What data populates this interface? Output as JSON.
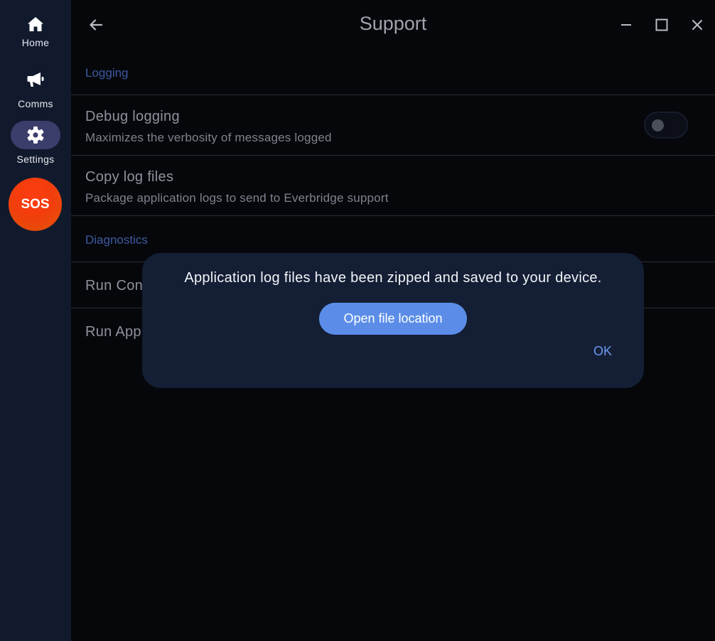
{
  "sidebar": {
    "items": [
      {
        "label": "Home",
        "icon": "home-icon"
      },
      {
        "label": "Comms",
        "icon": "megaphone-icon"
      },
      {
        "label": "Settings",
        "icon": "gear-icon",
        "active": true
      }
    ],
    "sos_label": "SOS"
  },
  "header": {
    "title": "Support"
  },
  "sections": {
    "logging": {
      "header": "Logging",
      "debug_logging": {
        "title": "Debug logging",
        "subtitle": "Maximizes the verbosity of messages logged",
        "toggle_on": false
      },
      "copy_log_files": {
        "title": "Copy log files",
        "subtitle": "Package application logs to send to Everbridge support"
      }
    },
    "diagnostics": {
      "header": "Diagnostics",
      "row1_title": "Run Con",
      "row2_title": "Run App"
    }
  },
  "dialog": {
    "message": "Application log files have been zipped and saved to your device.",
    "open_button": "Open file location",
    "ok_button": "OK"
  },
  "colors": {
    "sidebar_bg": "#111a2d",
    "main_bg": "#06070b",
    "accent": "#5b8de8",
    "section_header": "#3f5aa0",
    "sos": "#f23d0c",
    "dialog_bg": "#141f35"
  }
}
